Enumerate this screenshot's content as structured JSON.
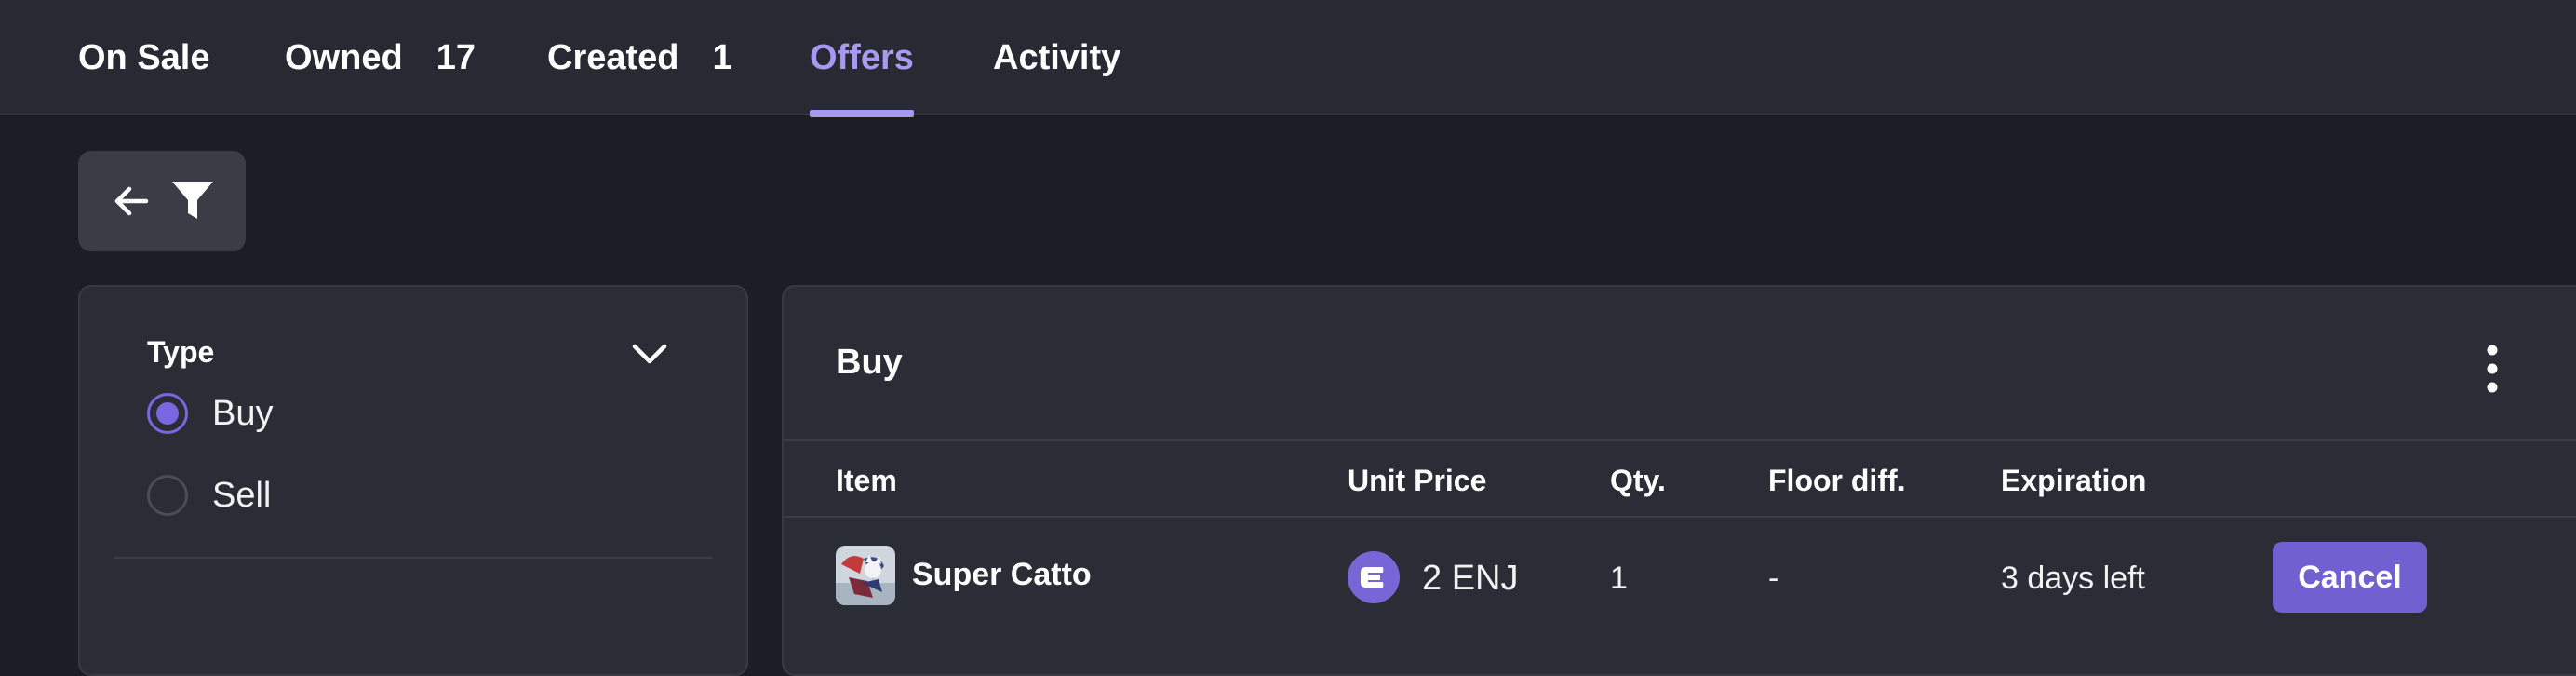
{
  "tabs": [
    {
      "label": "On Sale",
      "count": ""
    },
    {
      "label": "Owned",
      "count": "17"
    },
    {
      "label": "Created",
      "count": "1"
    },
    {
      "label": "Offers",
      "count": "",
      "active": true
    },
    {
      "label": "Activity",
      "count": ""
    }
  ],
  "toolbar": {
    "back_icon": "arrow-left-icon",
    "filter_icon": "filter-icon"
  },
  "filters": {
    "type_label": "Type",
    "options": [
      {
        "label": "Buy",
        "checked": true
      },
      {
        "label": "Sell",
        "checked": false
      }
    ]
  },
  "offers": {
    "title": "Buy",
    "columns": [
      "Item",
      "Unit Price",
      "Qty.",
      "Floor diff.",
      "Expiration"
    ],
    "rows": [
      {
        "item": "Super Catto",
        "price": "2 ENJ",
        "qty": "1",
        "floor_diff": "-",
        "expiration": "3 days left",
        "action": "Cancel"
      }
    ]
  },
  "colors": {
    "accent": "#a898f0",
    "button": "#7060d0",
    "panel": "#2a2d35",
    "background": "#1b1e25"
  }
}
